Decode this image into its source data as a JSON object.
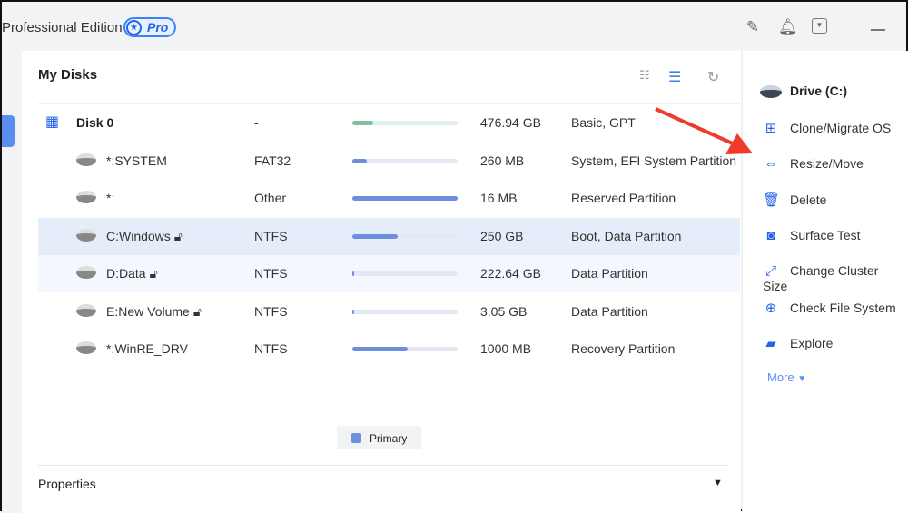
{
  "titlebar": {
    "title": "Professional Edition",
    "badge": "Pro",
    "icons": [
      "notes-icon",
      "bell-icon",
      "dropdown-icon",
      "minimize-icon"
    ]
  },
  "main": {
    "heading": "My Disks",
    "toolbar_icons": [
      "grid-view-icon",
      "list-view-icon",
      "refresh-icon"
    ],
    "rows": [
      {
        "name": "Disk 0",
        "fs": "-",
        "usage": 0.2,
        "size": "476.94 GB",
        "type": "Basic, GPT",
        "bar_color": "#7cc2a0",
        "disk": true
      },
      {
        "name": "*:SYSTEM",
        "fs": "FAT32",
        "usage": 0.14,
        "size": "260 MB",
        "type": "System, EFI System Partition"
      },
      {
        "name": "*:",
        "fs": "Other",
        "usage": 1.0,
        "size": "16 MB",
        "type": "Reserved Partition"
      },
      {
        "name": "C:Windows",
        "fs": "NTFS",
        "usage": 0.43,
        "size": "250 GB",
        "type": "Boot, Data Partition",
        "locked": true,
        "selected": true
      },
      {
        "name": "D:Data",
        "fs": "NTFS",
        "usage": 0.02,
        "size": "222.64 GB",
        "type": "Data Partition",
        "locked": true
      },
      {
        "name": "E:New Volume",
        "fs": "NTFS",
        "usage": 0.02,
        "size": "3.05 GB",
        "type": "Data Partition",
        "locked": true
      },
      {
        "name": "*:WinRE_DRV",
        "fs": "NTFS",
        "usage": 0.53,
        "size": "1000 MB",
        "type": "Recovery Partition"
      }
    ],
    "legend": "Primary",
    "properties": "Properties"
  },
  "side": {
    "title": "Drive (C:)",
    "items": [
      {
        "label": "Clone/Migrate OS",
        "icon": "windows-icon"
      },
      {
        "label": "Resize/Move",
        "icon": "resize-icon"
      },
      {
        "label": "Delete",
        "icon": "trash-icon"
      },
      {
        "label": "Surface Test",
        "icon": "surface-test-icon"
      },
      {
        "label": "Change Cluster Size",
        "icon": "cluster-icon"
      },
      {
        "label": "Check File System",
        "icon": "check-fs-icon"
      },
      {
        "label": "Explore",
        "icon": "folder-search-icon"
      }
    ],
    "more": "More"
  },
  "colors": {
    "accent": "#2563eb",
    "selected_row": "#e6edfa",
    "annotation_arrow": "#ef3b2c"
  }
}
